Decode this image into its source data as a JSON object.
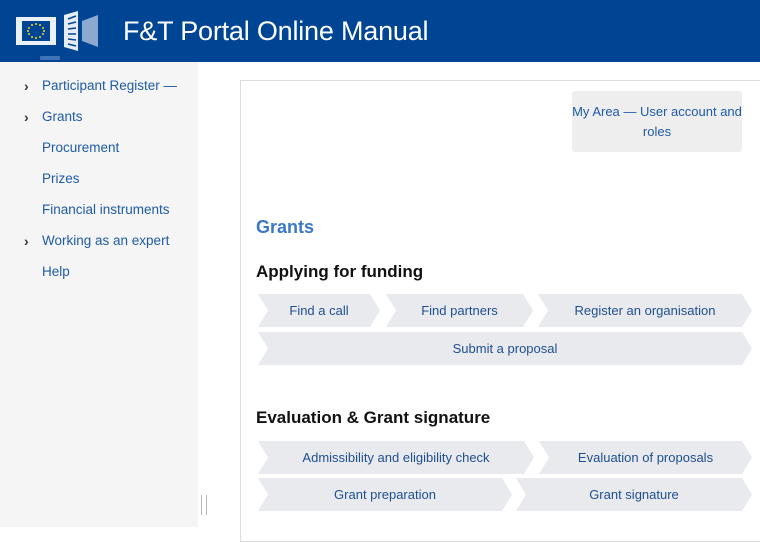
{
  "header": {
    "title": "F&T Portal Online Manual",
    "logo_icon": "eu-commission-logo-icon"
  },
  "sidebar": {
    "items": [
      {
        "label": "Participant Register —",
        "expandable": true
      },
      {
        "label": "Grants",
        "expandable": true
      },
      {
        "label": "Procurement",
        "expandable": false
      },
      {
        "label": "Prizes",
        "expandable": false
      },
      {
        "label": "Financial instruments",
        "expandable": false
      },
      {
        "label": "Working as an expert",
        "expandable": true
      },
      {
        "label": "Help",
        "expandable": false
      }
    ],
    "chevron_glyph": "›"
  },
  "main": {
    "my_area_button": "My Area — User account and roles",
    "section_title": "Grants",
    "applying": {
      "heading": "Applying for funding",
      "steps": [
        "Find a call",
        "Find partners",
        "Register an organisation",
        "Submit a proposal"
      ]
    },
    "evaluation": {
      "heading": "Evaluation & Grant signature",
      "steps": [
        "Admissibility and eligibility check",
        "Evaluation of proposals",
        "Grant preparation",
        "Grant signature"
      ]
    }
  },
  "colors": {
    "header_bg": "#004494",
    "link": "#1f5ba6",
    "section_title": "#3b78c5",
    "step_bg": "#e8eaed"
  }
}
